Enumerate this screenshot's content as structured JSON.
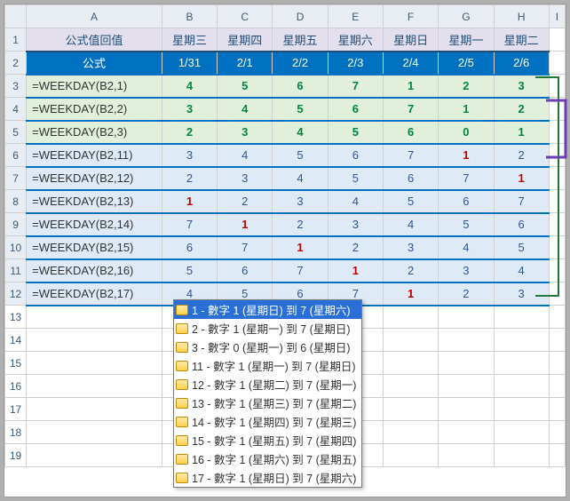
{
  "columns": [
    "A",
    "B",
    "C",
    "D",
    "E",
    "F",
    "G",
    "H",
    "I"
  ],
  "rows": [
    "1",
    "2",
    "3",
    "4",
    "5",
    "6",
    "7",
    "8",
    "9",
    "10",
    "11",
    "12",
    "13",
    "14",
    "15",
    "16",
    "17",
    "18",
    "19"
  ],
  "header1": {
    "A": "公式值回值",
    "cells": [
      "星期三",
      "星期四",
      "星期五",
      "星期六",
      "星期日",
      "星期一",
      "星期二"
    ]
  },
  "header2": {
    "A": "公式",
    "cells": [
      "1/31",
      "2/1",
      "2/2",
      "2/3",
      "2/4",
      "2/5",
      "2/6"
    ]
  },
  "data": [
    {
      "formula": "=WEEKDAY(B2,1)",
      "band": "g",
      "red": -1,
      "vals": [
        4,
        5,
        6,
        7,
        1,
        2,
        3
      ]
    },
    {
      "formula": "=WEEKDAY(B2,2)",
      "band": "g",
      "red": -1,
      "vals": [
        3,
        4,
        5,
        6,
        7,
        1,
        2
      ]
    },
    {
      "formula": "=WEEKDAY(B2,3)",
      "band": "g",
      "red": -1,
      "vals": [
        2,
        3,
        4,
        5,
        6,
        0,
        1
      ]
    },
    {
      "formula": "=WEEKDAY(B2,11)",
      "band": "b",
      "red": 5,
      "vals": [
        3,
        4,
        5,
        6,
        7,
        1,
        2
      ]
    },
    {
      "formula": "=WEEKDAY(B2,12)",
      "band": "b",
      "red": 6,
      "vals": [
        2,
        3,
        4,
        5,
        6,
        7,
        1
      ]
    },
    {
      "formula": "=WEEKDAY(B2,13)",
      "band": "b",
      "red": 0,
      "vals": [
        1,
        2,
        3,
        4,
        5,
        6,
        7
      ]
    },
    {
      "formula": "=WEEKDAY(B2,14)",
      "band": "b",
      "red": 1,
      "vals": [
        7,
        1,
        2,
        3,
        4,
        5,
        6
      ]
    },
    {
      "formula": "=WEEKDAY(B2,15)",
      "band": "b",
      "red": 2,
      "vals": [
        6,
        7,
        1,
        2,
        3,
        4,
        5
      ]
    },
    {
      "formula": "=WEEKDAY(B2,16)",
      "band": "b",
      "red": 3,
      "vals": [
        5,
        6,
        7,
        1,
        2,
        3,
        4
      ]
    },
    {
      "formula": "=WEEKDAY(B2,17)",
      "band": "b",
      "red": 4,
      "vals": [
        4,
        5,
        6,
        7,
        1,
        2,
        3
      ]
    }
  ],
  "tooltip": {
    "selected": 0,
    "items": [
      "1 - 數字 1 (星期日) 到 7 (星期六)",
      "2 - 數字 1 (星期一) 到 7 (星期日)",
      "3 - 數字 0 (星期一) 到 6 (星期日)",
      "11 - 數字 1 (星期一) 到 7 (星期日)",
      "12 - 數字 1 (星期二) 到 7 (星期一)",
      "13 - 數字 1 (星期三) 到 7 (星期二)",
      "14 - 數字 1 (星期四) 到 7 (星期三)",
      "15 - 數字 1 (星期五) 到 7 (星期四)",
      "16 - 數字 1 (星期六) 到 7 (星期五)",
      "17 - 數字 1 (星期日) 到 7 (星期六)"
    ]
  }
}
